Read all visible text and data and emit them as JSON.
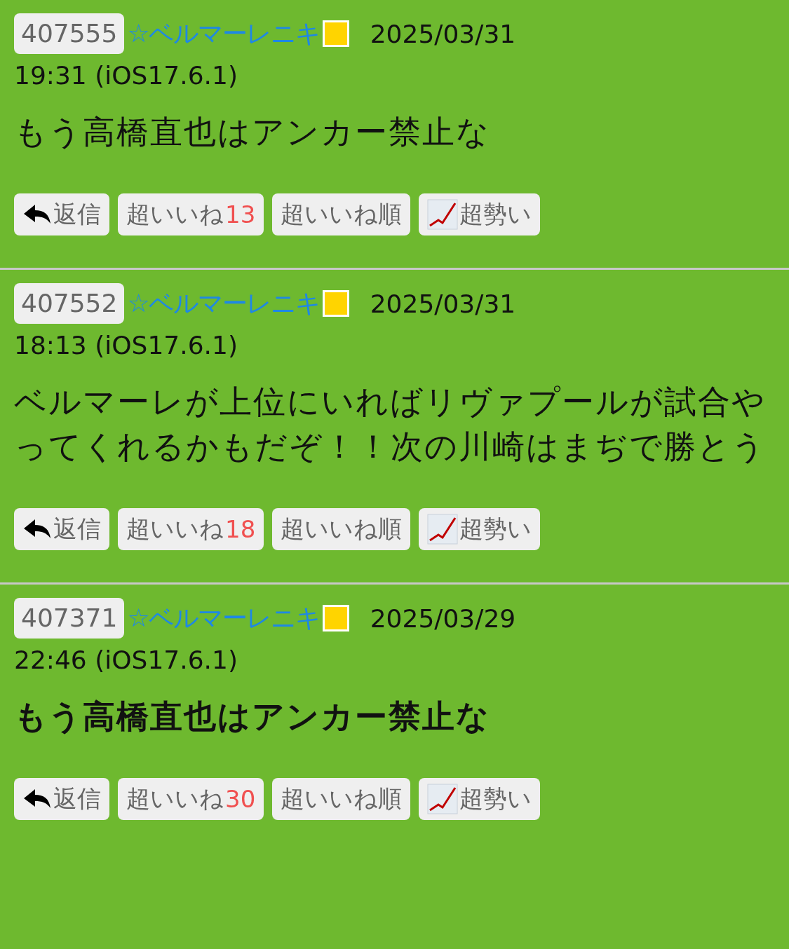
{
  "posts": [
    {
      "number": "407555",
      "author": "☆ベルマーレニキ",
      "date": "2025/03/31",
      "time": "19:31 (iOS17.6.1)",
      "body": "もう高橋直也はアンカー禁止な",
      "bold": false,
      "actions": {
        "reply": "返信",
        "like": "超いいね",
        "like_count": "13",
        "sort": "超いいね順",
        "trend": "超勢い"
      }
    },
    {
      "number": "407552",
      "author": "☆ベルマーレニキ",
      "date": "2025/03/31",
      "time": "18:13 (iOS17.6.1)",
      "body": "ベルマーレが上位にいればリヴァプールが試合やってくれるかもだぞ！！次の川崎はまぢで勝とう",
      "bold": false,
      "actions": {
        "reply": "返信",
        "like": "超いいね",
        "like_count": "18",
        "sort": "超いいね順",
        "trend": "超勢い"
      }
    },
    {
      "number": "407371",
      "author": "☆ベルマーレニキ",
      "date": "2025/03/29",
      "time": "22:46 (iOS17.6.1)",
      "body": "もう高橋直也はアンカー禁止な",
      "bold": true,
      "actions": {
        "reply": "返信",
        "like": "超いいね",
        "like_count": "30",
        "sort": "超いいね順",
        "trend": "超勢い"
      }
    }
  ]
}
